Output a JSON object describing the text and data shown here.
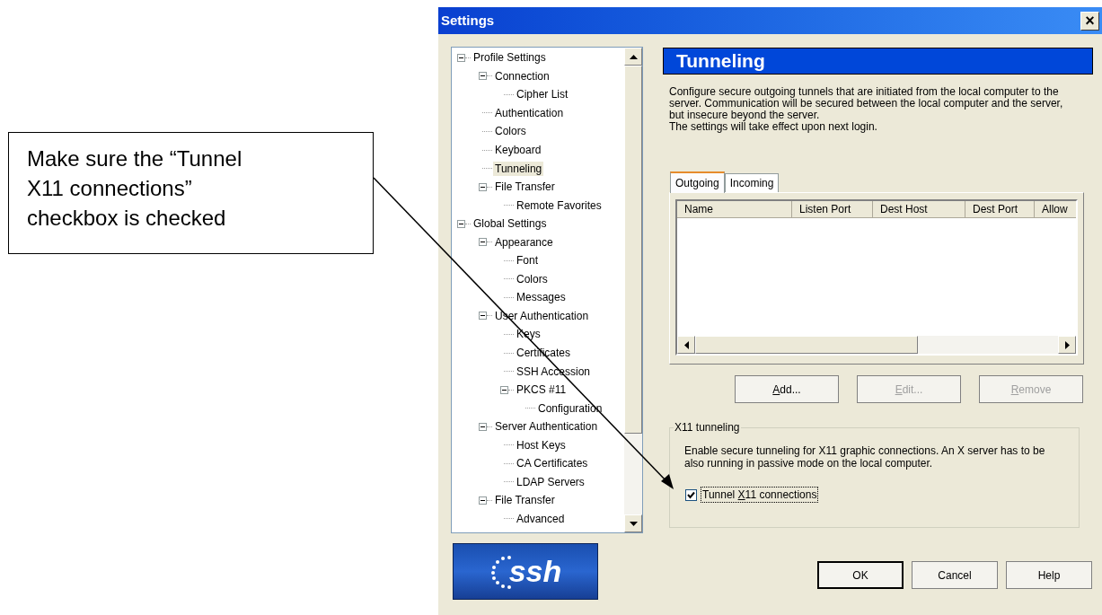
{
  "callout": {
    "text": "Make sure the “Tunnel X11 connections” checkbox is checked"
  },
  "window": {
    "title": "Settings",
    "close": "×"
  },
  "tree": [
    {
      "label": "Profile Settings",
      "expanded": true,
      "selected": false,
      "children": [
        {
          "label": "Connection",
          "expanded": true,
          "selected": false,
          "children": [
            {
              "label": "Cipher List",
              "selected": false
            }
          ]
        },
        {
          "label": "Authentication",
          "selected": false
        },
        {
          "label": "Colors",
          "selected": false
        },
        {
          "label": "Keyboard",
          "selected": false
        },
        {
          "label": "Tunneling",
          "selected": true
        },
        {
          "label": "File Transfer",
          "expanded": true,
          "selected": false,
          "children": [
            {
              "label": "Remote Favorites",
              "selected": false
            }
          ]
        }
      ]
    },
    {
      "label": "Global Settings",
      "expanded": true,
      "selected": false,
      "children": [
        {
          "label": "Appearance",
          "expanded": true,
          "selected": false,
          "children": [
            {
              "label": "Font",
              "selected": false
            },
            {
              "label": "Colors",
              "selected": false
            },
            {
              "label": "Messages",
              "selected": false
            }
          ]
        },
        {
          "label": "User Authentication",
          "expanded": true,
          "selected": false,
          "children": [
            {
              "label": "Keys",
              "selected": false
            },
            {
              "label": "Certificates",
              "selected": false
            },
            {
              "label": "SSH Accession",
              "selected": false
            },
            {
              "label": "PKCS #11",
              "expanded": true,
              "selected": false,
              "children": [
                {
                  "label": "Configuration",
                  "selected": false
                }
              ]
            }
          ]
        },
        {
          "label": "Server Authentication",
          "expanded": true,
          "selected": false,
          "children": [
            {
              "label": "Host Keys",
              "selected": false
            },
            {
              "label": "CA Certificates",
              "selected": false
            },
            {
              "label": "LDAP Servers",
              "selected": false
            }
          ]
        },
        {
          "label": "File Transfer",
          "expanded": true,
          "selected": false,
          "children": [
            {
              "label": "Advanced",
              "selected": false
            }
          ]
        }
      ]
    }
  ],
  "logo": {
    "text": "ssh"
  },
  "panel": {
    "title": "Tunneling",
    "description": "Configure secure outgoing tunnels that are initiated from the local computer to the server. Communication will be secured between the local computer and the server, but insecure beyond the server.\nThe settings will take effect upon next login."
  },
  "tabs": [
    {
      "label": "Outgoing",
      "selected": true
    },
    {
      "label": "Incoming",
      "selected": false
    }
  ],
  "table": {
    "columns": [
      "Name",
      "Listen Port",
      "Dest Host",
      "Dest Port",
      "Allow"
    ]
  },
  "list_buttons": [
    {
      "access_key": "A",
      "label_rest": "dd...",
      "disabled": false
    },
    {
      "access_key": "E",
      "label_rest": "dit...",
      "disabled": true
    },
    {
      "access_key": "R",
      "label_rest": "emove",
      "disabled": true
    }
  ],
  "x11": {
    "title": "X11 tunneling",
    "description": "Enable secure tunneling for X11 graphic connections. An X server has to be also running in passive mode on the local computer.",
    "checkbox": {
      "label_before": "Tunnel ",
      "access_key": "X",
      "label_rest": "11 connections",
      "checked": true
    }
  },
  "dialog_buttons": [
    {
      "label": "OK",
      "default": true
    },
    {
      "label": "Cancel",
      "default": false
    },
    {
      "label": "Help",
      "default": false
    }
  ]
}
